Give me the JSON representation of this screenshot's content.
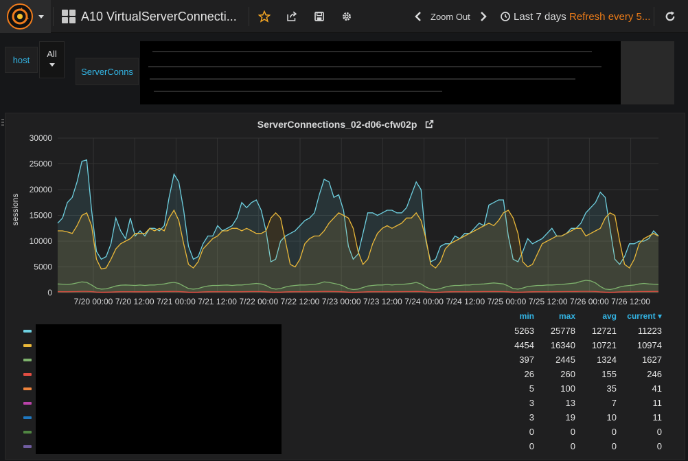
{
  "navbar": {
    "dashboard_title": "A10 VirtualServerConnecti...",
    "zoom_out": "Zoom Out",
    "time_range": "Last 7 days",
    "refresh": "Refresh every 5..."
  },
  "templating": {
    "host_label": "host",
    "host_value": "All",
    "serverconns_label": "ServerConns"
  },
  "panel": {
    "title": "ServerConnections_02-d06-cfw02p"
  },
  "legend": {
    "headers": [
      "min",
      "max",
      "avg",
      "current ▾"
    ],
    "rows": [
      {
        "color": "#6ed0e0",
        "min": "5263",
        "max": "25778",
        "avg": "12721",
        "current": "11223"
      },
      {
        "color": "#eab839",
        "min": "4454",
        "max": "16340",
        "avg": "10721",
        "current": "10974"
      },
      {
        "color": "#7eb26d",
        "min": "397",
        "max": "2445",
        "avg": "1324",
        "current": "1627"
      },
      {
        "color": "#e24d42",
        "min": "26",
        "max": "260",
        "avg": "155",
        "current": "246"
      },
      {
        "color": "#ef843c",
        "min": "5",
        "max": "100",
        "avg": "35",
        "current": "41"
      },
      {
        "color": "#ba43a9",
        "min": "3",
        "max": "13",
        "avg": "7",
        "current": "11"
      },
      {
        "color": "#1f78c1",
        "min": "3",
        "max": "19",
        "avg": "10",
        "current": "11"
      },
      {
        "color": "#508642",
        "min": "0",
        "max": "0",
        "avg": "0",
        "current": "0"
      },
      {
        "color": "#705da0",
        "min": "0",
        "max": "0",
        "avg": "0",
        "current": "0"
      }
    ]
  },
  "chart_data": {
    "type": "area",
    "ylabel": "sessions",
    "ylim": [
      0,
      30000
    ],
    "y_ticks": [
      "0",
      "5000",
      "10000",
      "15000",
      "20000",
      "25000",
      "30000"
    ],
    "x_ticks": [
      "7/20 00:00",
      "7/20 12:00",
      "7/21 00:00",
      "7/21 12:00",
      "7/22 00:00",
      "7/22 12:00",
      "7/23 00:00",
      "7/23 12:00",
      "7/24 00:00",
      "7/24 12:00",
      "7/25 00:00",
      "7/25 12:00",
      "7/26 00:00",
      "7/26 12:00"
    ],
    "grid": true,
    "series": [
      {
        "color": "#6ed0e0",
        "values": [
          13500,
          14500,
          17500,
          18500,
          21500,
          25500,
          25778,
          16000,
          8000,
          6500,
          7000,
          9500,
          14500,
          12000,
          10500,
          14500,
          11000,
          12000,
          11000,
          12500,
          12500,
          12000,
          13000,
          18500,
          23000,
          21500,
          16000,
          9000,
          6500,
          7000,
          9500,
          11000,
          11000,
          13000,
          12000,
          12500,
          13000,
          14500,
          17500,
          16500,
          17500,
          18000,
          16000,
          12000,
          6000,
          6500,
          10000,
          11000,
          11500,
          12000,
          13000,
          14000,
          14500,
          15500,
          19000,
          22000,
          21500,
          18500,
          19000,
          16000,
          9000,
          6500,
          7500,
          11500,
          15500,
          15500,
          15000,
          15500,
          16000,
          16000,
          15500,
          15500,
          16500,
          19000,
          21500,
          20000,
          10000,
          6000,
          6500,
          9000,
          9500,
          9500,
          11000,
          10500,
          11500,
          11500,
          12500,
          13500,
          13000,
          17000,
          17500,
          18000,
          18000,
          11000,
          6500,
          6000,
          8000,
          10500,
          9500,
          10000,
          10500,
          11500,
          12500,
          11000,
          11000,
          11500,
          12500,
          12500,
          13500,
          15500,
          16500,
          17500,
          19500,
          18500,
          12500,
          6500,
          5500,
          7000,
          9500,
          9500,
          10000,
          10000,
          10500,
          12000,
          11000
        ]
      },
      {
        "color": "#eab839",
        "values": [
          12000,
          12000,
          11800,
          11500,
          13000,
          15000,
          15500,
          13000,
          6500,
          4600,
          4800,
          6500,
          8500,
          9500,
          10000,
          10500,
          11500,
          11500,
          11500,
          12500,
          12000,
          12500,
          12000,
          14500,
          16000,
          14000,
          9500,
          5500,
          4800,
          6000,
          8500,
          9500,
          10500,
          11000,
          12000,
          12000,
          12500,
          12500,
          12000,
          12500,
          12000,
          11500,
          11500,
          12000,
          14500,
          15500,
          14500,
          10000,
          5500,
          5000,
          6500,
          9500,
          10500,
          11000,
          11000,
          12000,
          13500,
          14500,
          15500,
          15000,
          14500,
          12500,
          8000,
          5500,
          6500,
          9500,
          11500,
          12500,
          13000,
          12500,
          13000,
          13500,
          14500,
          14500,
          15500,
          14000,
          10500,
          5500,
          4800,
          6000,
          8500,
          9500,
          10000,
          10500,
          11000,
          11500,
          12000,
          12500,
          13000,
          13500,
          13000,
          14000,
          15500,
          16000,
          14500,
          11500,
          6000,
          5000,
          5500,
          7500,
          9500,
          10000,
          10500,
          11000,
          11000,
          11500,
          12000,
          12500,
          12500,
          11000,
          11500,
          12000,
          12500,
          14500,
          15500,
          15000,
          10000,
          5500,
          4800,
          6500,
          9500,
          10500,
          11000,
          11500,
          10974
        ]
      },
      {
        "color": "#7eb26d",
        "values": [
          1700,
          1650,
          1600,
          1700,
          1900,
          2100,
          2000,
          1500,
          900,
          700,
          750,
          1000,
          1300,
          1450,
          1500,
          1450,
          1400,
          1500,
          1400,
          1500,
          1500,
          1600,
          1700,
          1900,
          2000,
          1800,
          1300,
          800,
          700,
          800,
          1100,
          1300,
          1400,
          1400,
          1450,
          1500,
          1400,
          1500,
          1500,
          1600,
          1700,
          1800,
          1700,
          1400,
          900,
          700,
          800,
          1100,
          1300,
          1400,
          1500,
          1500,
          1550,
          1600,
          1800,
          2100,
          2000,
          1800,
          1600,
          1300,
          800,
          600,
          700,
          1000,
          1300,
          1400,
          1500,
          1500,
          1600,
          1500,
          1600,
          1600,
          1700,
          1800,
          2000,
          1700,
          1100,
          700,
          600,
          800,
          1100,
          1300,
          1400,
          1400,
          1500,
          1500,
          1600,
          1650,
          1700,
          1800,
          1900,
          1800,
          1700,
          1300,
          800,
          700,
          900,
          1200,
          1300,
          1400,
          1400,
          1500,
          1500,
          1550,
          1600,
          1700,
          1800,
          1900,
          2200,
          2400,
          2300,
          1900,
          1200,
          700,
          600,
          800,
          1100,
          1300,
          1400,
          1500,
          1700,
          1800,
          1700,
          1650,
          1627
        ]
      },
      {
        "color": "#e24d42",
        "values": [
          200,
          190,
          180,
          200,
          220,
          250,
          260,
          200,
          120,
          80,
          90,
          120,
          160,
          180,
          190,
          180,
          170,
          180,
          170,
          190,
          190,
          200,
          210,
          230,
          250,
          220,
          160,
          100,
          80,
          100,
          140,
          170,
          180,
          180,
          190,
          190,
          180,
          190,
          190,
          200,
          210,
          220,
          210,
          170,
          110,
          90,
          100,
          140,
          170,
          180,
          190,
          190,
          195,
          200,
          220,
          250,
          240,
          220,
          200,
          160,
          100,
          70,
          90,
          130,
          170,
          180,
          190,
          190,
          200,
          190,
          200,
          200,
          210,
          220,
          240,
          210,
          140,
          90,
          70,
          100,
          140,
          170,
          180,
          180,
          190,
          190,
          200,
          205,
          210,
          220,
          230,
          220,
          210,
          170,
          100,
          90,
          110,
          150,
          170,
          180,
          180,
          190,
          190,
          195,
          200,
          210,
          220,
          230,
          250,
          260,
          250,
          230,
          150,
          90,
          70,
          100,
          140,
          170,
          180,
          190,
          210,
          220,
          230,
          240,
          246
        ]
      }
    ]
  }
}
